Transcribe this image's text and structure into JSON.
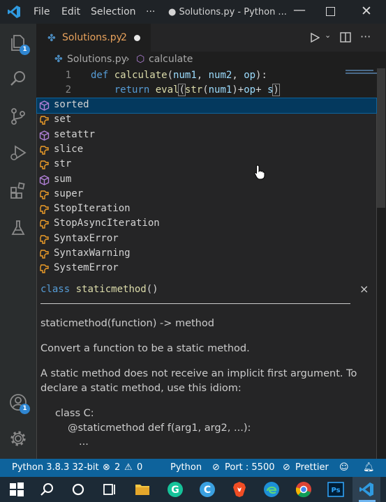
{
  "menu": {
    "file": "File",
    "edit": "Edit",
    "selection": "Selection",
    "more": "···",
    "window_title": "● Solutions.py - Python ..."
  },
  "activity": {
    "explorer_badge": "1",
    "account_badge": "1"
  },
  "tab": {
    "filename": "Solutions.py",
    "problems": "2"
  },
  "breadcrumb": {
    "file": "Solutions.py",
    "symbol": "calculate"
  },
  "editor": {
    "line1_no": "1",
    "line2_no": "2",
    "line1": {
      "kw": "def",
      "fn": "calculate",
      "open": "(",
      "p1": "num1",
      "c1": ", ",
      "p2": "num2",
      "c2": ", ",
      "p3": "op",
      "close": "):"
    },
    "line2": {
      "kw": "return",
      "fn": "eval",
      "open": "(",
      "fn2": "str",
      "open2": "(",
      "p1": "num1",
      "close2": ")",
      "plus1": "+",
      "p2": "op",
      "plus2": "+ ",
      "p3": "s",
      "close": ")"
    }
  },
  "suggestions": [
    {
      "label": "sorted",
      "icon": "cube-icon"
    },
    {
      "label": "set",
      "icon": "class-icon"
    },
    {
      "label": "setattr",
      "icon": "cube-icon"
    },
    {
      "label": "slice",
      "icon": "class-icon"
    },
    {
      "label": "str",
      "icon": "class-icon"
    },
    {
      "label": "sum",
      "icon": "cube-icon"
    },
    {
      "label": "super",
      "icon": "class-icon"
    },
    {
      "label": "StopIteration",
      "icon": "class-icon"
    },
    {
      "label": "StopAsyncIteration",
      "icon": "class-icon"
    },
    {
      "label": "SyntaxError",
      "icon": "class-icon"
    },
    {
      "label": "SyntaxWarning",
      "icon": "class-icon"
    },
    {
      "label": "SystemError",
      "icon": "class-icon"
    }
  ],
  "docs": {
    "sig_kw": "class",
    "sig_name": "staticmethod",
    "sig_paren": "()",
    "close": "×",
    "line1": "staticmethod(function) -> method",
    "line2": "Convert a function to be a static method.",
    "line3a": "A static method does not receive an implicit first argument. To",
    "line3b": "declare a static method, use this idiom:",
    "code1": "class C:",
    "code2": "@staticmethod def f(arg1, arg2, ...):",
    "code3": "..."
  },
  "status": {
    "python": "Python 3.8.3 32-bit",
    "errors": "2",
    "warnings": "0",
    "language": "Python",
    "port": "Port : 5500",
    "prettier": "Prettier"
  },
  "colors": {
    "status_bar": "#0e639c",
    "tab_label": "#e8a25c",
    "keyword": "#569cd6",
    "function": "#dcdcaa",
    "param": "#9cdcfe"
  }
}
